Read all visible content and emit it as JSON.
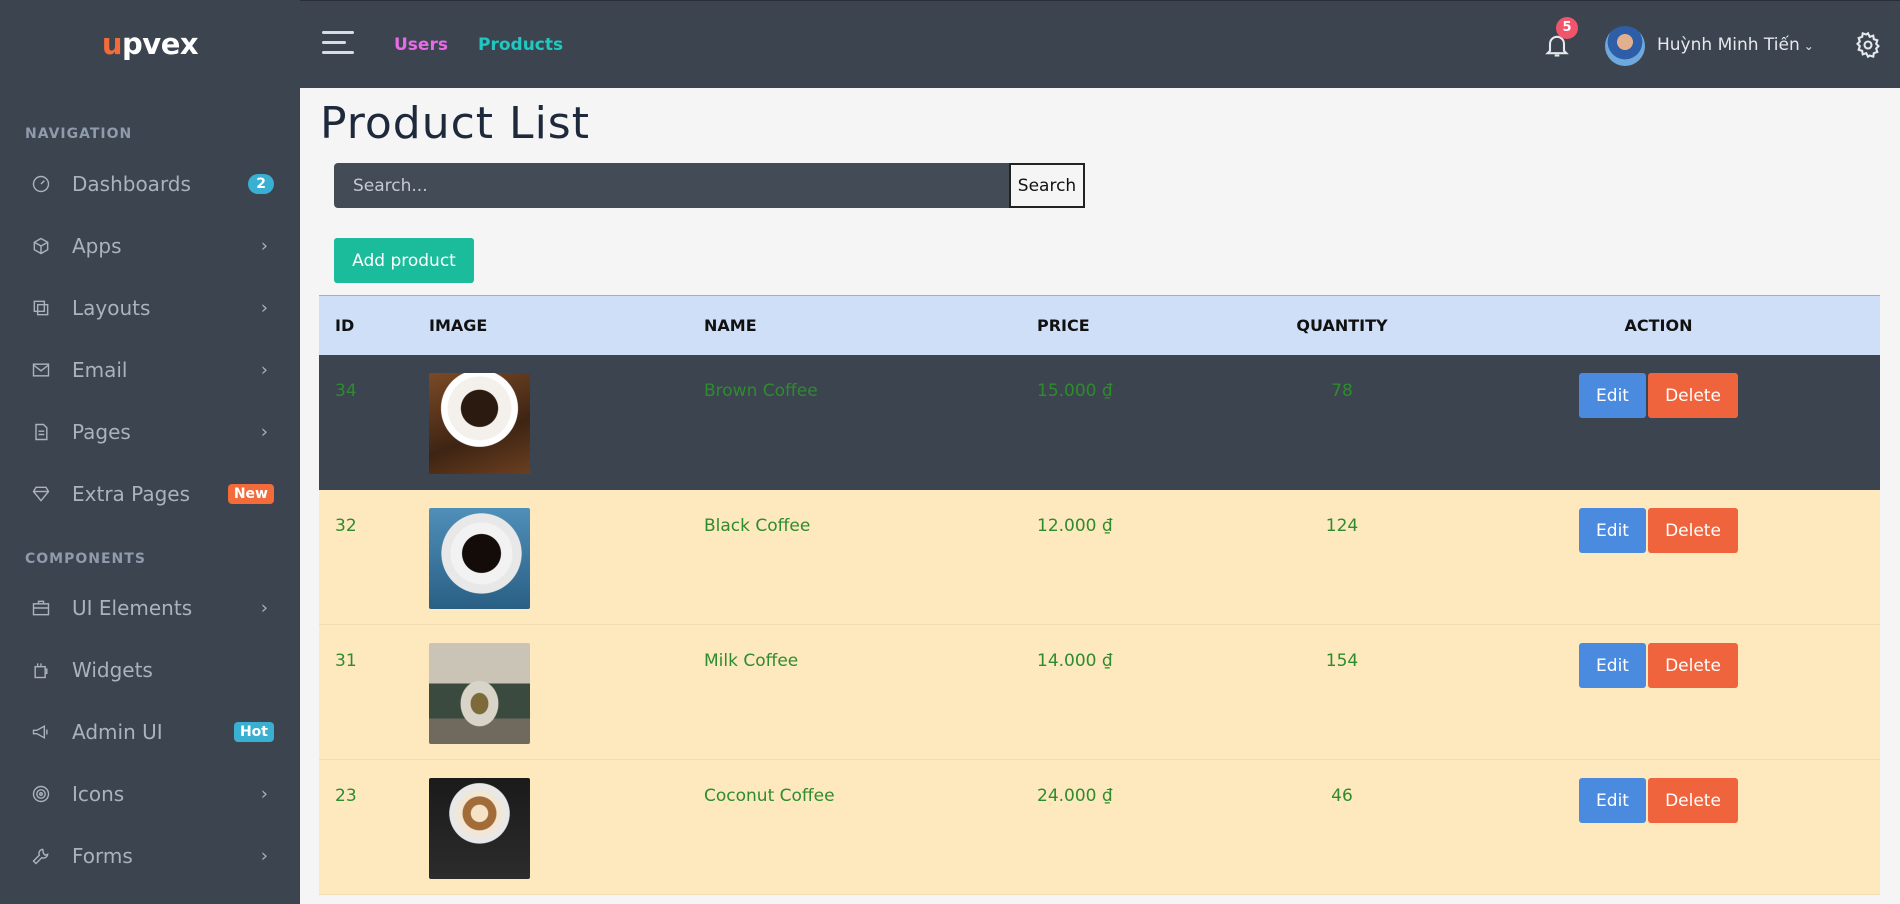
{
  "brand": {
    "logo_first": "u",
    "logo_rest": "pvex"
  },
  "sidebar": {
    "navigation_title": "NAVIGATION",
    "components_title": "COMPONENTS",
    "items": [
      {
        "label": "Dashboards",
        "icon": "dashboard-icon",
        "badge": "2"
      },
      {
        "label": "Apps",
        "icon": "cube-icon"
      },
      {
        "label": "Layouts",
        "icon": "layers-icon"
      },
      {
        "label": "Email",
        "icon": "mail-icon"
      },
      {
        "label": "Pages",
        "icon": "file-icon"
      },
      {
        "label": "Extra Pages",
        "icon": "diamond-icon",
        "badge": "New"
      }
    ],
    "component_items": [
      {
        "label": "UI Elements",
        "icon": "briefcase-icon"
      },
      {
        "label": "Widgets",
        "icon": "gift-icon"
      },
      {
        "label": "Admin UI",
        "icon": "megaphone-icon",
        "badge": "Hot"
      },
      {
        "label": "Icons",
        "icon": "target-icon"
      },
      {
        "label": "Forms",
        "icon": "wrench-icon"
      }
    ],
    "chevron": "›"
  },
  "topbar": {
    "links": [
      "Users",
      "Products"
    ],
    "notification_count": "5",
    "username": "Huỳnh Minh Tiến",
    "user_caret": "⌄"
  },
  "main": {
    "title": "Product List",
    "search_placeholder": "Search...",
    "search_button": "Search",
    "add_button": "Add product"
  },
  "table": {
    "headers": [
      "ID",
      "IMAGE",
      "NAME",
      "PRICE",
      "QUANTITY",
      "ACTION"
    ],
    "rows": [
      {
        "id": "34",
        "name": "Brown Coffee",
        "price": "15.000 ₫",
        "quantity": "78",
        "edit": "Edit",
        "delete": "Delete"
      },
      {
        "id": "32",
        "name": "Black Coffee",
        "price": "12.000 ₫",
        "quantity": "124",
        "edit": "Edit",
        "delete": "Delete"
      },
      {
        "id": "31",
        "name": "Milk Coffee",
        "price": "14.000 ₫",
        "quantity": "154",
        "edit": "Edit",
        "delete": "Delete"
      },
      {
        "id": "23",
        "name": "Coconut Coffee",
        "price": "24.000 ₫",
        "quantity": "46",
        "edit": "Edit",
        "delete": "Delete"
      }
    ]
  },
  "colors": {
    "sidebar_bg": "#3c4450",
    "accent_green": "#1abc9c",
    "edit_blue": "#4a8be0",
    "delete_orange": "#f0643d",
    "row_highlight": "#fde9bd",
    "header_bg": "#cfdff7"
  }
}
